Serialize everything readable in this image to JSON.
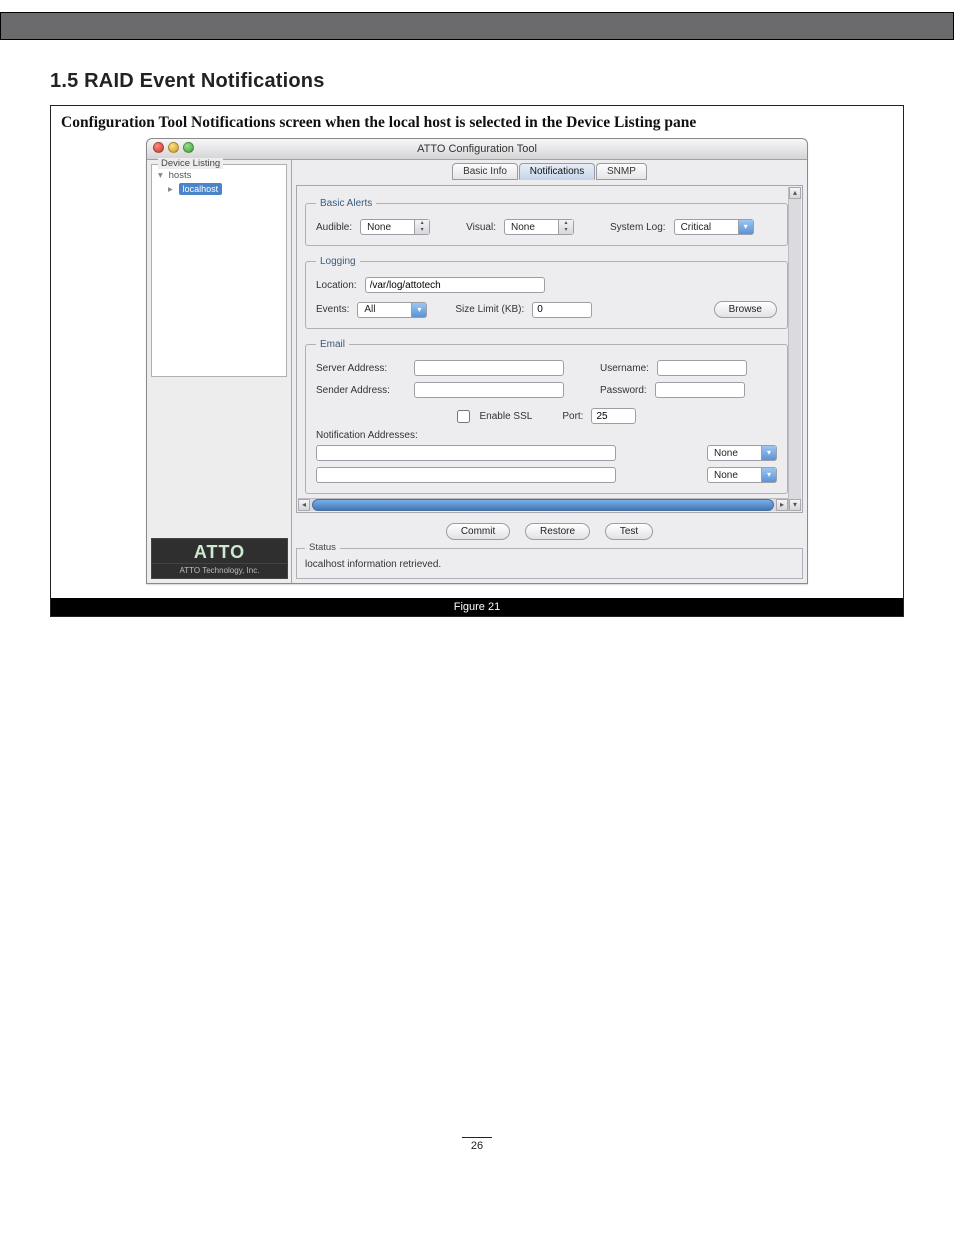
{
  "doc": {
    "section_title": "1.5 RAID Event Notifications",
    "caption": "Configuration Tool Notifications screen when the local host is selected in the Device Listing pane",
    "figure_label": "Figure 21",
    "page_number": "26"
  },
  "window": {
    "title": "ATTO Configuration Tool",
    "sidebar": {
      "legend": "Device Listing",
      "root": "hosts",
      "selected_host": "localhost"
    },
    "brand": {
      "logo": "ATTO",
      "subtitle": "ATTO Technology, Inc."
    },
    "tabs": {
      "items": [
        "Basic Info",
        "Notifications",
        "SNMP"
      ],
      "selected_index": 1
    },
    "basic_alerts": {
      "legend": "Basic Alerts",
      "audible_label": "Audible:",
      "audible_value": "None",
      "visual_label": "Visual:",
      "visual_value": "None",
      "system_log_label": "System Log:",
      "system_log_value": "Critical"
    },
    "logging": {
      "legend": "Logging",
      "location_label": "Location:",
      "location_value": "/var/log/attotech",
      "events_label": "Events:",
      "events_value": "All",
      "size_limit_label": "Size Limit (KB):",
      "size_limit_value": "0",
      "browse_label": "Browse"
    },
    "email": {
      "legend": "Email",
      "server_label": "Server Address:",
      "server_value": "",
      "username_label": "Username:",
      "username_value": "",
      "sender_label": "Sender Address:",
      "sender_value": "",
      "password_label": "Password:",
      "password_value": "",
      "enable_ssl_label": "Enable SSL",
      "port_label": "Port:",
      "port_value": "25",
      "notif_addr_label": "Notification Addresses:",
      "addr1_severity": "None",
      "addr2_severity": "None"
    },
    "buttons": {
      "commit": "Commit",
      "restore": "Restore",
      "test": "Test"
    },
    "status": {
      "legend": "Status",
      "message": "localhost information retrieved."
    }
  }
}
